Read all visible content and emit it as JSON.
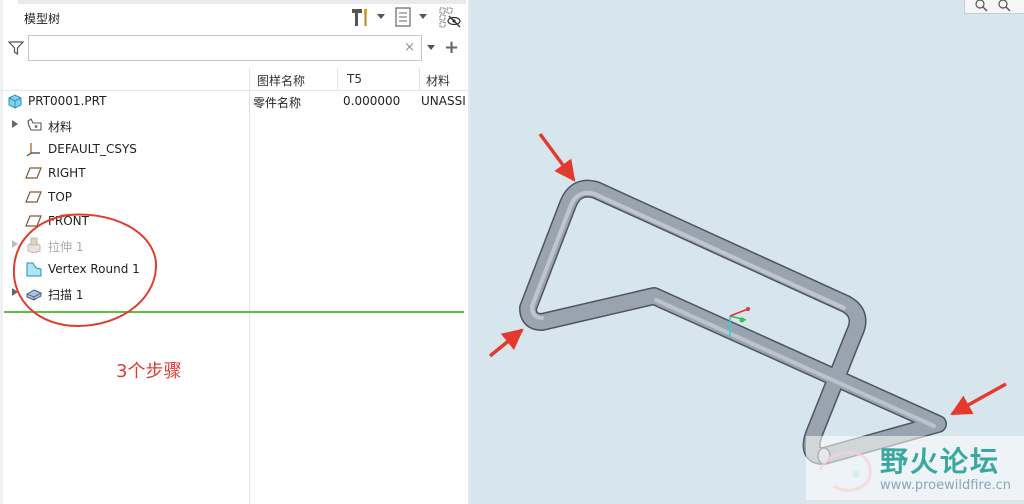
{
  "header": {
    "title": "模型树"
  },
  "filter": {
    "placeholder": "",
    "value": "",
    "clear": "×",
    "add": "+"
  },
  "columns": [
    "图样名称",
    "T5",
    "材料"
  ],
  "tree": [
    {
      "label": "PRT0001.PRT",
      "icon": "part-icon",
      "expand": false,
      "cells": [
        "零件名称",
        "0.000000",
        "UNASSI"
      ]
    },
    {
      "label": "材料",
      "icon": "material-icon",
      "expand": true,
      "cells": [
        "",
        "",
        ""
      ]
    },
    {
      "label": "DEFAULT_CSYS",
      "icon": "csys-icon",
      "expand": false,
      "cells": [
        "",
        "",
        ""
      ]
    },
    {
      "label": "RIGHT",
      "icon": "datum-plane-icon",
      "expand": false,
      "cells": [
        "",
        "",
        ""
      ]
    },
    {
      "label": "TOP",
      "icon": "datum-plane-icon",
      "expand": false,
      "cells": [
        "",
        "",
        ""
      ]
    },
    {
      "label": "FRONT",
      "icon": "datum-plane-icon",
      "expand": false,
      "cells": [
        "",
        "",
        ""
      ]
    },
    {
      "label": "拉伸 1",
      "icon": "extrude-icon",
      "expand": true,
      "dim": true,
      "cells": [
        "",
        "",
        ""
      ]
    },
    {
      "label": "Vertex Round 1",
      "icon": "vertex-round-icon",
      "expand": false,
      "cells": [
        "",
        "",
        ""
      ]
    },
    {
      "label": "扫描 1",
      "icon": "sweep-icon",
      "expand": true,
      "cells": [
        "",
        "",
        ""
      ]
    }
  ],
  "annotation": {
    "text": "3个步骤",
    "color": "#e23b2e"
  },
  "watermark": {
    "title": "野火论坛",
    "url": "www.proewildfire.cn"
  },
  "colors": {
    "viewport_bg": "#d7e5ec",
    "insert_line": "#5fbf45",
    "pipe": "#9aa4b0"
  }
}
